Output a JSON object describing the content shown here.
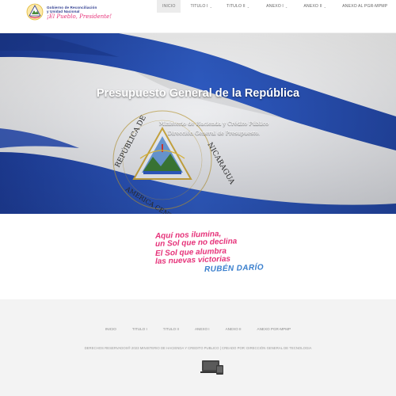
{
  "header": {
    "logo": {
      "line1": "Gobierno de Reconciliación",
      "line2": "y Unidad Nacional",
      "slogan": "¡El Pueblo, Presidente!"
    },
    "nav": [
      {
        "label": "INICIO",
        "active": true,
        "dropdown": false
      },
      {
        "label": "TITULO I",
        "active": false,
        "dropdown": true
      },
      {
        "label": "TITULO II",
        "active": false,
        "dropdown": true
      },
      {
        "label": "ANEXO I",
        "active": false,
        "dropdown": true
      },
      {
        "label": "ANEXO II",
        "active": false,
        "dropdown": true
      },
      {
        "label": "ANEXO AL PGR-MPMP",
        "active": false,
        "dropdown": false
      }
    ]
  },
  "hero": {
    "title": "Presupuesto General de la República",
    "subtitle1": "Ministerio de Hacienda y Crédito Público",
    "subtitle2": "Dirección General de Presupuesto.",
    "emblem_text": "REPUBLICA DE NICARAGUA · AMERICA CENTRAL",
    "colors": {
      "blue": "#2a4fb5",
      "white": "#f4f4f4"
    }
  },
  "quote": {
    "line1": "Aquí nos ilumina,",
    "line2": "un Sol que no declina",
    "line3": "El Sol que alumbra",
    "line4": "las nuevas victorias",
    "author": "RUBÉN DARÍO",
    "colors": {
      "pink": "#e6337a",
      "blue": "#3a7fcd"
    }
  },
  "footer": {
    "links": [
      "INICIO",
      "TITULO I",
      "TITULO II",
      "ANEXO I",
      "ANEXO II",
      "ANEXO PGR-MPMP"
    ],
    "copyright": "DERECHOS RESERVADOS® 2023 MINISTERIO DE HACIENDA Y CREDITO PUBLICO | CREADO POR: DIRECCIÓN GENERAL DE TECNOLOGIA",
    "device_icon": "devices-icon"
  }
}
